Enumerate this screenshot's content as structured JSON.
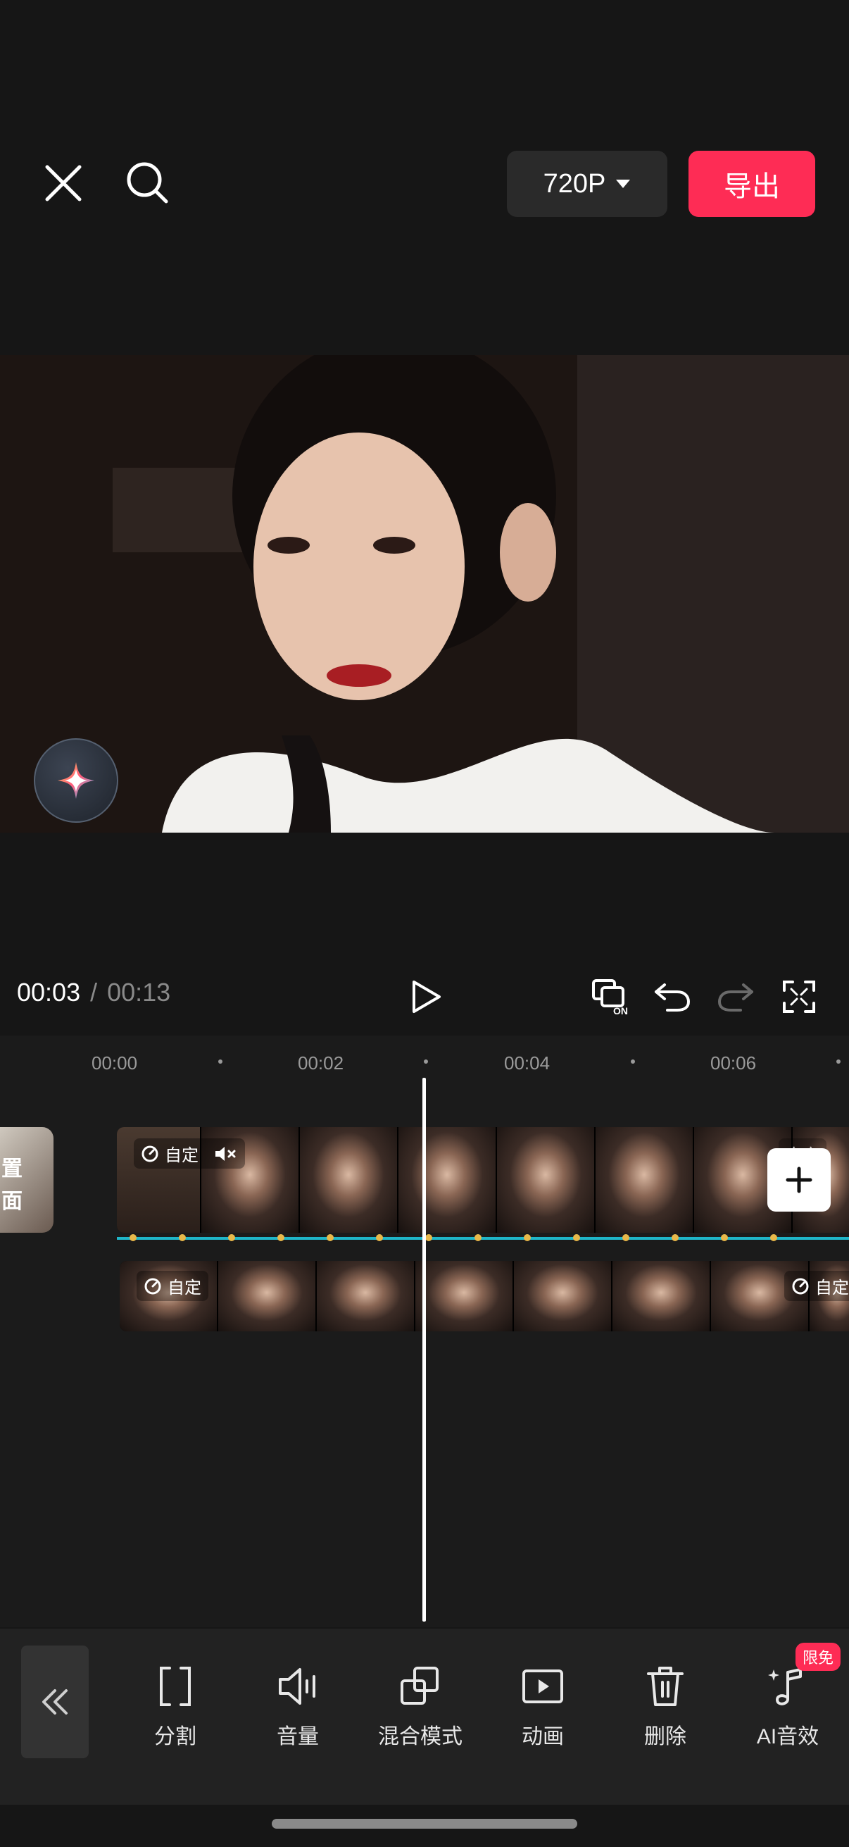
{
  "header": {
    "resolution_label": "720P",
    "export_label": "导出"
  },
  "playback": {
    "current_time": "00:03",
    "separator": "/",
    "total_time": "00:13"
  },
  "timeline": {
    "ruler_labels": [
      "00:00",
      "00:02",
      "00:04",
      "00:06"
    ],
    "cover_text_line1": "置",
    "cover_text_line2": "面",
    "clip_label_main": "自定",
    "clip_label_second": "自定",
    "clip_label_second_right": "自定",
    "clip_label_main_right": "自定"
  },
  "toolbar": {
    "items": [
      {
        "label": "分割",
        "icon": "split-icon"
      },
      {
        "label": "音量",
        "icon": "volume-icon"
      },
      {
        "label": "混合模式",
        "icon": "blend-mode-icon"
      },
      {
        "label": "动画",
        "icon": "animation-icon"
      },
      {
        "label": "删除",
        "icon": "delete-icon"
      },
      {
        "label": "AI音效",
        "icon": "ai-sound-icon"
      }
    ],
    "badge": "限免"
  },
  "colors": {
    "accent": "#fe2c55",
    "keyframe_line": "#1fb6c9",
    "keyframe_dot": "#e8b84a"
  }
}
